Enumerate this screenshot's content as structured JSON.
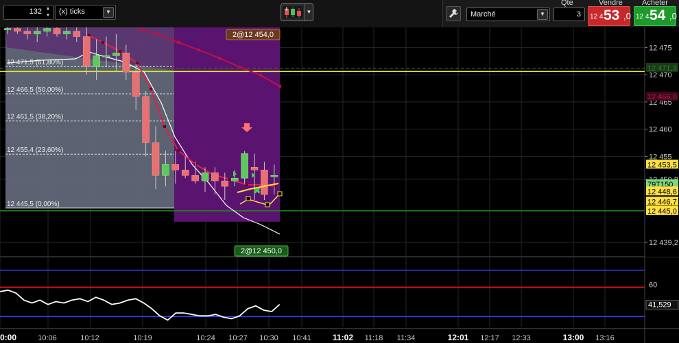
{
  "toolbar": {
    "period_value": "132",
    "unit_label": "(x) ticks",
    "chart_type_icon": "candles-icon",
    "order": {
      "market_label": "Marché",
      "qty_label": "Qte",
      "qty_value": "3",
      "sell_label": "Vendre",
      "sell_price_small": "12 4",
      "sell_price_big": "53",
      "sell_price_dec": ",0",
      "buy_label": "Acheter",
      "buy_price_small": "12 4",
      "buy_price_big": "54",
      "buy_price_dec": ",0"
    }
  },
  "colors": {
    "up": "#5ec85e",
    "down": "#e87070",
    "purple": "#5a1470",
    "ma": "#e0204a",
    "grid": "#262626",
    "fib_line": "#dddddd",
    "fib_bg": "#6c7386",
    "yellow": "#ffe040",
    "green_line": "#1f8a1f"
  },
  "chart_data": {
    "type": "candlestick",
    "price_axis": {
      "min": 12437,
      "max": 12480,
      "ticks": [
        {
          "v": 12475,
          "label": "12 475"
        },
        {
          "v": 12470,
          "label": "12 470"
        },
        {
          "v": 12465,
          "label": "12 465"
        },
        {
          "v": 12460,
          "label": "12 460"
        },
        {
          "v": 12455,
          "label": "12 455"
        },
        {
          "v": 12450.8,
          "label": "12 450,8"
        },
        {
          "v": 12439.2,
          "label": "12 439,2"
        }
      ]
    },
    "price_markers": [
      {
        "v": 12471.3,
        "label": "12 471,3",
        "bg": "#1a3a1a",
        "fg": "#1f8a1f"
      },
      {
        "v": 12466.0,
        "label": "12 466,0",
        "bg": "#3a0a1a",
        "fg": "#d01050"
      },
      {
        "v": 12453.5,
        "label": "12 453,5",
        "bg": "#ffe040",
        "fg": "#000"
      },
      {
        "v": 12449.9,
        "label": "79T150",
        "bg": "#7fd87f",
        "fg": "#000"
      },
      {
        "v": 12448.6,
        "label": "12 448,6",
        "bg": "#ffe040",
        "fg": "#000"
      },
      {
        "v": 12446.7,
        "label": "12 446,7",
        "bg": "#ffe040",
        "fg": "#000"
      },
      {
        "v": 12445.0,
        "label": "12 445,0",
        "bg": "#ffe040",
        "fg": "#000"
      }
    ],
    "fib_levels": [
      {
        "v": 12471.5,
        "label": "12 471,5 (61,80%)"
      },
      {
        "v": 12466.5,
        "label": "12 466,5 (50,00%)"
      },
      {
        "v": 12461.5,
        "label": "12 461,5 (38,20%)"
      },
      {
        "v": 12455.4,
        "label": "12 455,4 (23,60%)"
      },
      {
        "v": 12445.5,
        "label": "12 445,5 (0,00%)"
      }
    ],
    "horizontal_lines": [
      {
        "v": 12470.6,
        "color": "#e8e830",
        "style": "solid"
      },
      {
        "v": 12471.2,
        "color": "#1f8a1f",
        "style": "dash"
      },
      {
        "v": 12445.0,
        "color": "#1f8a1f",
        "style": "solid"
      }
    ],
    "order_flags": [
      {
        "label": "2@12 454,0",
        "bg": "#6a3a20",
        "border": "#c07040",
        "position": "top"
      },
      {
        "label": "2@12 450,0",
        "bg": "#1a5a1a",
        "border": "#40c040",
        "position": "bottom"
      }
    ],
    "time_labels": [
      {
        "label": "0:00",
        "bold": true
      },
      {
        "label": "10:06",
        "bold": false
      },
      {
        "label": "10:12",
        "bold": false
      },
      {
        "label": "10:19",
        "bold": false
      },
      {
        "label": "10:24",
        "bold": false
      },
      {
        "label": "10:27",
        "bold": false
      },
      {
        "label": "10:30",
        "bold": false
      },
      {
        "label": "10:41",
        "bold": false
      },
      {
        "label": "11:02",
        "bold": true
      },
      {
        "label": "11:18",
        "bold": false
      },
      {
        "label": "11:34",
        "bold": false
      },
      {
        "label": "12:01",
        "bold": true
      },
      {
        "label": "12:17",
        "bold": false
      },
      {
        "label": "12:33",
        "bold": false
      },
      {
        "label": "13:00",
        "bold": true
      },
      {
        "label": "13:16",
        "bold": false
      }
    ],
    "candles": [
      {
        "o": 12478.5,
        "h": 12479.5,
        "l": 12477.5,
        "c": 12478.5
      },
      {
        "o": 12478.5,
        "h": 12479.5,
        "l": 12477.5,
        "c": 12478.0
      },
      {
        "o": 12478.0,
        "h": 12479.0,
        "l": 12476.5,
        "c": 12477.5
      },
      {
        "o": 12477.5,
        "h": 12479.0,
        "l": 12476.0,
        "c": 12478.0
      },
      {
        "o": 12478.0,
        "h": 12479.5,
        "l": 12477.0,
        "c": 12478.5
      },
      {
        "o": 12478.5,
        "h": 12479.5,
        "l": 12477.0,
        "c": 12477.5
      },
      {
        "o": 12477.5,
        "h": 12479.0,
        "l": 12476.5,
        "c": 12478.0
      },
      {
        "o": 12478.0,
        "h": 12479.0,
        "l": 12476.0,
        "c": 12477.0
      },
      {
        "o": 12477.0,
        "h": 12479.5,
        "l": 12470.0,
        "c": 12471.5
      },
      {
        "o": 12471.5,
        "h": 12476.5,
        "l": 12469.0,
        "c": 12473.5
      },
      {
        "o": 12473.5,
        "h": 12477.0,
        "l": 12471.5,
        "c": 12473.5
      },
      {
        "o": 12473.5,
        "h": 12477.5,
        "l": 12470.5,
        "c": 12474.0
      },
      {
        "o": 12474.0,
        "h": 12475.5,
        "l": 12469.0,
        "c": 12470.5
      },
      {
        "o": 12470.5,
        "h": 12472.0,
        "l": 12463.5,
        "c": 12466.0
      },
      {
        "o": 12466.0,
        "h": 12467.0,
        "l": 12455.0,
        "c": 12457.5
      },
      {
        "o": 12457.5,
        "h": 12460.5,
        "l": 12449.0,
        "c": 12451.5
      },
      {
        "o": 12451.5,
        "h": 12456.0,
        "l": 12449.5,
        "c": 12453.5
      },
      {
        "o": 12453.5,
        "h": 12456.0,
        "l": 12450.0,
        "c": 12452.5
      },
      {
        "o": 12452.5,
        "h": 12455.0,
        "l": 12451.0,
        "c": 12451.5
      },
      {
        "o": 12451.5,
        "h": 12454.0,
        "l": 12450.0,
        "c": 12450.5
      },
      {
        "o": 12450.5,
        "h": 12453.0,
        "l": 12448.5,
        "c": 12452.0
      },
      {
        "o": 12452.0,
        "h": 12453.0,
        "l": 12448.0,
        "c": 12450.5
      },
      {
        "o": 12450.5,
        "h": 12452.0,
        "l": 12447.0,
        "c": 12449.5
      },
      {
        "o": 12450.5,
        "h": 12452.5,
        "l": 12449.5,
        "c": 12451.0
      },
      {
        "o": 12451.0,
        "h": 12456.0,
        "l": 12450.0,
        "c": 12455.5
      },
      {
        "o": 12453.0,
        "h": 12455.5,
        "l": 12447.0,
        "c": 12452.5
      },
      {
        "o": 12452.5,
        "h": 12454.0,
        "l": 12447.0,
        "c": 12448.0
      },
      {
        "o": 12451.5,
        "h": 12453.5,
        "l": 12448.0,
        "c": 12451.5
      }
    ],
    "oscillator": {
      "min": 30,
      "max": 78,
      "upper_line": 70,
      "mid_line": 58,
      "lower_line": 37.5,
      "ticks": [
        {
          "v": 60,
          "label": "60"
        }
      ],
      "current_label": "41,529",
      "values": [
        55,
        56,
        54,
        49,
        47,
        49,
        46,
        48,
        47,
        49,
        50,
        48,
        51,
        49,
        46,
        47,
        49,
        50,
        47,
        43,
        38,
        35,
        40,
        40,
        39,
        38,
        38,
        39,
        37,
        36,
        38,
        43,
        45,
        42,
        41,
        46
      ]
    }
  }
}
